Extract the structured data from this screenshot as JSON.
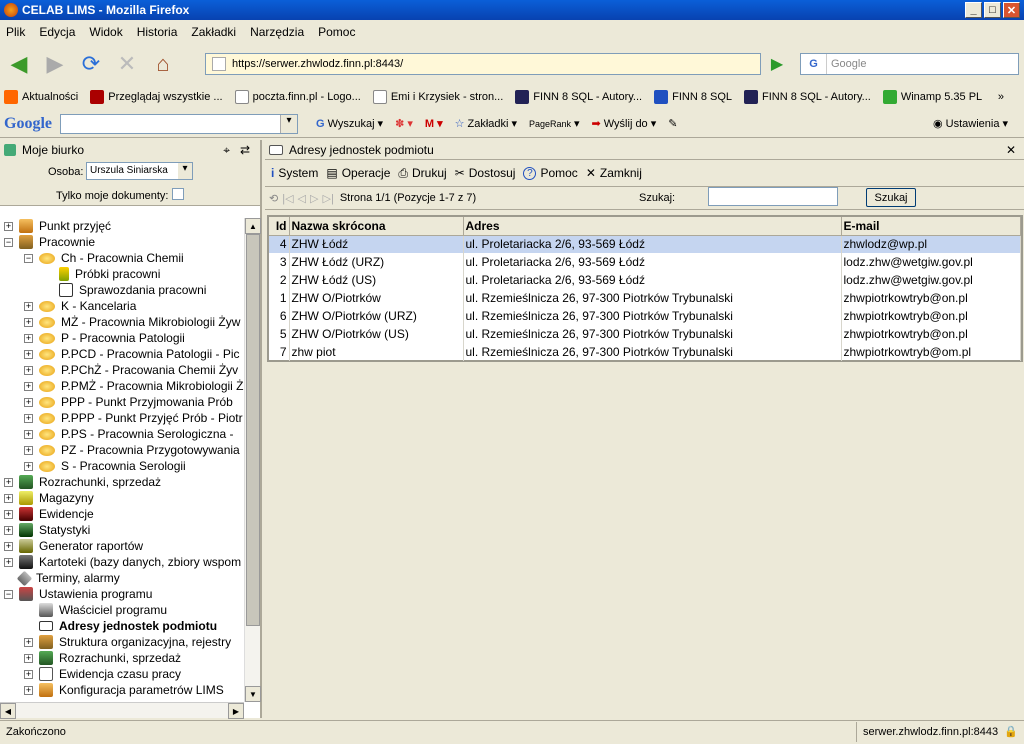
{
  "window": {
    "title": "CELAB LIMS - Mozilla Firefox",
    "btn_min": "_",
    "btn_max": "□",
    "btn_close": "✕"
  },
  "menu": [
    "Plik",
    "Edycja",
    "Widok",
    "Historia",
    "Zakładki",
    "Narzędzia",
    "Pomoc"
  ],
  "nav": {
    "url": "https://serwer.zhwlodz.finn.pl:8443/",
    "search_placeholder": "Google"
  },
  "bookmarks": [
    "Aktualności",
    "Przeglądaj wszystkie ...",
    "poczta.finn.pl - Logo...",
    "Emi i Krzysiek - stron...",
    "FINN 8 SQL - Autory...",
    "FINN 8 SQL",
    "FINN 8 SQL - Autory...",
    "Winamp 5.35 PL"
  ],
  "google_toolbar": {
    "logo": "Google",
    "search": "Wyszukaj",
    "bookmarks": "Zakładki",
    "pagerank": "PageRank",
    "send": "Wyślij do",
    "settings": "Ustawienia"
  },
  "left": {
    "title": "Moje biurko",
    "person_label": "Osoba:",
    "person_value": "Urszula Siniarska",
    "only_mine_label": "Tylko moje dokumenty:",
    "tree": [
      {
        "label": "Punkt przyjęć",
        "lvl": 0,
        "pm": "+",
        "icon": "person"
      },
      {
        "label": "Pracownie",
        "lvl": 0,
        "pm": "−",
        "icon": "org"
      },
      {
        "label": "Ch - Pracownia Chemii",
        "lvl": 1,
        "pm": "−",
        "icon": "oval"
      },
      {
        "label": "Próbki pracowni",
        "lvl": 2,
        "pm": "",
        "icon": "flask"
      },
      {
        "label": "Sprawozdania pracowni",
        "lvl": 2,
        "pm": "",
        "icon": "report"
      },
      {
        "label": "K - Kancelaria",
        "lvl": 1,
        "pm": "+",
        "icon": "oval"
      },
      {
        "label": "MŻ - Pracownia Mikrobiologii Żyw",
        "lvl": 1,
        "pm": "+",
        "icon": "oval"
      },
      {
        "label": "P - Pracownia Patologii",
        "lvl": 1,
        "pm": "+",
        "icon": "oval"
      },
      {
        "label": "P.PCD - Pracownia Patologii - Pic",
        "lvl": 1,
        "pm": "+",
        "icon": "oval"
      },
      {
        "label": "P.PChŻ - Pracowania Chemii Żyv",
        "lvl": 1,
        "pm": "+",
        "icon": "oval"
      },
      {
        "label": "P.PMŻ - Pracownia Mikrobiologii Ż",
        "lvl": 1,
        "pm": "+",
        "icon": "oval"
      },
      {
        "label": "PPP - Punkt Przyjmowania Prób",
        "lvl": 1,
        "pm": "+",
        "icon": "oval"
      },
      {
        "label": "P.PPP - Punkt Przyjęć Prób - Piotr",
        "lvl": 1,
        "pm": "+",
        "icon": "oval"
      },
      {
        "label": "P.PS - Pracownia Serologiczna - ",
        "lvl": 1,
        "pm": "+",
        "icon": "oval"
      },
      {
        "label": "PZ - Pracownia Przygotowywania",
        "lvl": 1,
        "pm": "+",
        "icon": "oval"
      },
      {
        "label": "S - Pracownia Serologii",
        "lvl": 1,
        "pm": "+",
        "icon": "oval"
      },
      {
        "label": "Rozrachunki, sprzedaż",
        "lvl": 0,
        "pm": "+",
        "icon": "money"
      },
      {
        "label": "Magazyny",
        "lvl": 0,
        "pm": "+",
        "icon": "box"
      },
      {
        "label": "Ewidencje",
        "lvl": 0,
        "pm": "+",
        "icon": "stack"
      },
      {
        "label": "Statystyki",
        "lvl": 0,
        "pm": "+",
        "icon": "chart"
      },
      {
        "label": "Generator raportów",
        "lvl": 0,
        "pm": "+",
        "icon": "gen"
      },
      {
        "label": "Kartoteki (bazy danych, zbiory wspom",
        "lvl": 0,
        "pm": "+",
        "icon": "db"
      },
      {
        "label": "Terminy, alarmy",
        "lvl": 0,
        "pm": "",
        "icon": "clock"
      },
      {
        "label": "Ustawienia programu",
        "lvl": 0,
        "pm": "−",
        "icon": "tools"
      },
      {
        "label": "Właściciel programu",
        "lvl": 1,
        "pm": "",
        "icon": "pen"
      },
      {
        "label": "Adresy jednostek podmiotu",
        "lvl": 1,
        "pm": "",
        "icon": "card",
        "bold": true
      },
      {
        "label": "Struktura organizacyjna, rejestry",
        "lvl": 1,
        "pm": "+",
        "icon": "org"
      },
      {
        "label": "Rozrachunki, sprzedaż",
        "lvl": 1,
        "pm": "+",
        "icon": "money"
      },
      {
        "label": "Ewidencja czasu pracy",
        "lvl": 1,
        "pm": "+",
        "icon": "ecp"
      },
      {
        "label": "Konfiguracja parametrów LIMS",
        "lvl": 1,
        "pm": "+",
        "icon": "person"
      }
    ]
  },
  "right": {
    "title": "Adresy jednostek podmiotu",
    "toolbar": [
      "System",
      "Operacje",
      "Drukuj",
      "Dostosuj",
      "Pomoc",
      "Zamknij"
    ],
    "pager": "Strona 1/1 (Pozycje 1-7 z 7)",
    "search_label": "Szukaj:",
    "search_btn": "Szukaj",
    "columns": [
      "Id",
      "Nazwa skrócona",
      "Adres",
      "E-mail"
    ],
    "rows": [
      [
        "4",
        "ZHW Łódź",
        "ul. Proletariacka 2/6, 93-569 Łódź",
        "zhwlodz@wp.pl"
      ],
      [
        "3",
        "ZHW Łódź (URZ)",
        "ul. Proletariacka 2/6, 93-569 Łódź",
        "lodz.zhw@wetgiw.gov.pl"
      ],
      [
        "2",
        "ZHW Łódź (US)",
        "ul. Proletariacka 2/6, 93-569 Łódź",
        "lodz.zhw@wetgiw.gov.pl"
      ],
      [
        "1",
        "ZHW O/Piotrków",
        "ul. Rzemieślnicza 26, 97-300 Piotrków Trybunalski",
        "zhwpiotrkowtryb@on.pl"
      ],
      [
        "6",
        "ZHW O/Piotrków (URZ)",
        "ul. Rzemieślnicza 26, 97-300 Piotrków Trybunalski",
        "zhwpiotrkowtryb@on.pl"
      ],
      [
        "5",
        "ZHW O/Piotrków (US)",
        "ul. Rzemieślnicza 26, 97-300 Piotrków Trybunalski",
        "zhwpiotrkowtryb@on.pl"
      ],
      [
        "7",
        "zhw piot",
        "ul. Rzemieślnicza 26, 97-300 Piotrków Trybunalski",
        "zhwpiotrkowtryb@om.pl"
      ]
    ]
  },
  "status": {
    "left": "Zakończono",
    "right": "serwer.zhwlodz.finn.pl:8443"
  }
}
